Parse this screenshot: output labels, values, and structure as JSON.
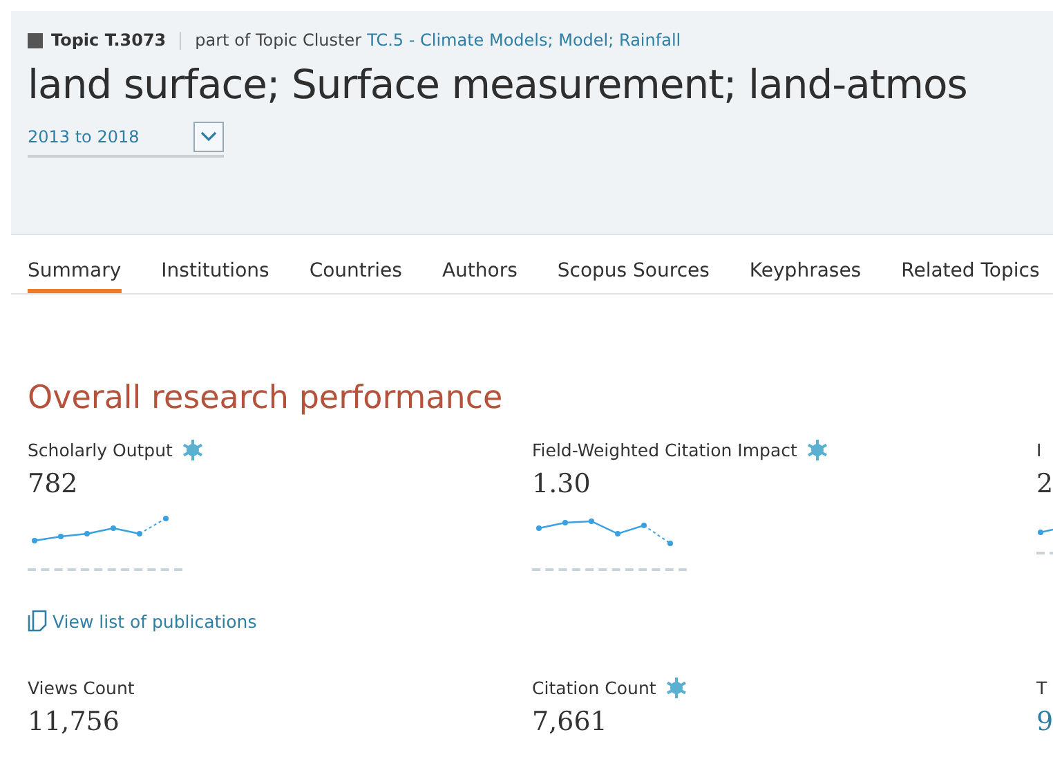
{
  "header": {
    "topic_id": "Topic T.3073",
    "cluster_prefix": "part of Topic Cluster",
    "cluster_link": "TC.5 - Climate Models; Model; Rainfall",
    "title": "land surface; Surface measurement; land-atmos",
    "year_range": "2013 to 2018"
  },
  "tabs": [
    {
      "label": "Summary",
      "selected": true
    },
    {
      "label": "Institutions",
      "selected": false
    },
    {
      "label": "Countries",
      "selected": false
    },
    {
      "label": "Authors",
      "selected": false
    },
    {
      "label": "Scopus Sources",
      "selected": false
    },
    {
      "label": "Keyphrases",
      "selected": false
    },
    {
      "label": "Related Topics",
      "selected": false
    }
  ],
  "section_title": "Overall research performance",
  "metrics_row_1": [
    {
      "label": "Scholarly Output",
      "value": "782",
      "badge": true
    },
    {
      "label": "Field-Weighted Citation Impact",
      "value": "1.30",
      "badge": true
    },
    {
      "label": "I",
      "value": "2",
      "badge": false
    }
  ],
  "publications_link": "View list of publications",
  "metrics_row_2": [
    {
      "label": "Views Count",
      "value": "11,756",
      "badge": false
    },
    {
      "label": "Citation Count",
      "value": "7,661",
      "badge": true
    },
    {
      "label": "T",
      "value": "9",
      "badge": false
    }
  ]
}
